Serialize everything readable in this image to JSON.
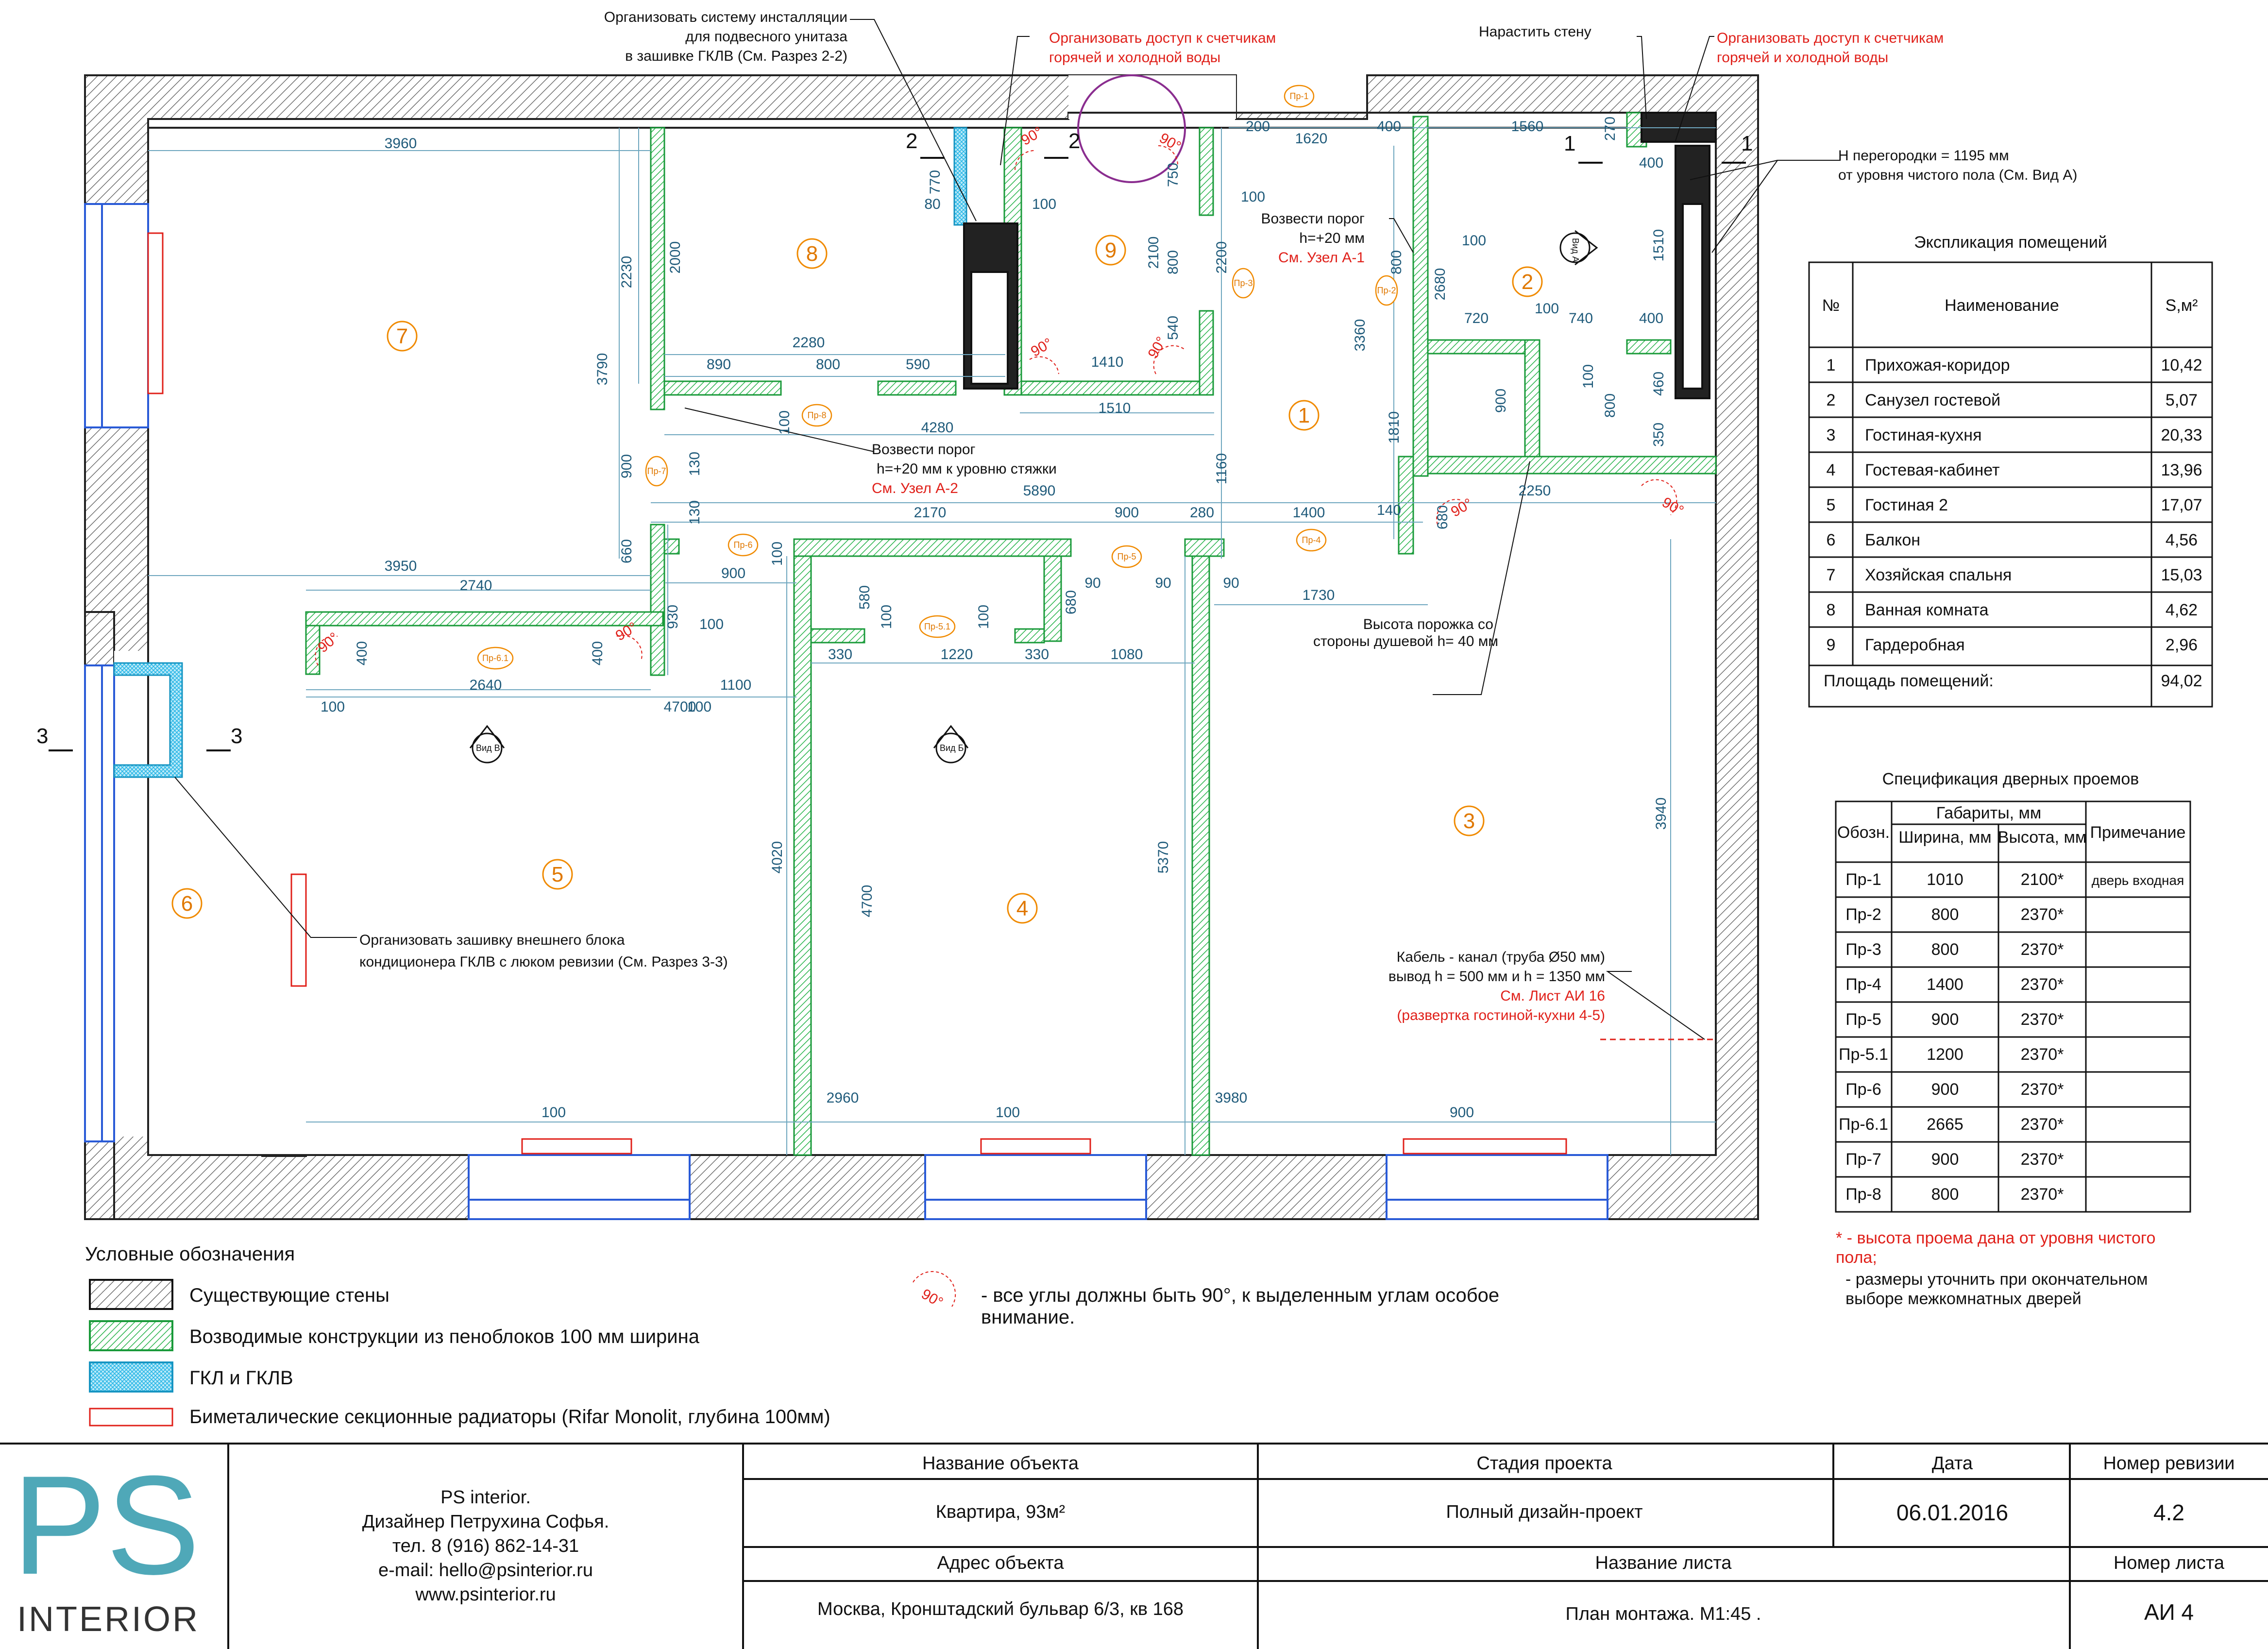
{
  "notes": {
    "installation": [
      "Организовать систему инсталляции",
      "для подвесного унитаза",
      "в зашивке ГКЛВ (См. Разрез 2-2)"
    ],
    "meters_1": [
      "Организовать доступ к счетчикам",
      "горячей и холодной воды"
    ],
    "meters_2": [
      "Организовать доступ к счетчикам",
      "горячей и холодной воды"
    ],
    "extend_wall": "Нарастить стену",
    "partition_height": [
      "Н перегородки = 1195 мм",
      "от уровня чистого пола  (См. Вид А)"
    ],
    "threshold_1": [
      "Возвести порог",
      "h=+20 мм"
    ],
    "threshold_1_ref": "См. Узел А-1",
    "threshold_2": [
      "Возвести порог",
      "h=+20 мм к уровню стяжки"
    ],
    "threshold_2_ref": "См. Узел А-2",
    "shower": [
      "Высота порожка со",
      "стороны душевой  h= 40 мм"
    ],
    "ac_unit": [
      "Организовать зашивку внешнего блока",
      "кондиционера ГКЛВ с люком ревизии  (См. Разрез 3-3)"
    ],
    "cable": [
      "Кабель - канал (труба Ø50 мм)",
      "вывод h = 500 мм и h = 1350 мм"
    ],
    "cable_ref": [
      "См. Лист АИ 16",
      "(развертка гостиной-кухни 4-5)"
    ],
    "angles": [
      "- все углы должны быть 90°, к выделенным углам особое",
      "внимание."
    ],
    "angle_mark": "90°",
    "view_a": "Вид А",
    "view_b": "Вид Б",
    "view_v": "Вид В",
    "sections": [
      "1",
      "2",
      "3"
    ]
  },
  "rooms": [
    "1",
    "2",
    "3",
    "4",
    "5",
    "6",
    "7",
    "8",
    "9"
  ],
  "doors": [
    "Пр-1",
    "Пр-2",
    "Пр-3",
    "Пр-4",
    "Пр-5",
    "Пр-5.1",
    "Пр-6",
    "Пр-6.1",
    "Пр-7",
    "Пр-8"
  ],
  "dims": [
    "3960",
    "2230",
    "2000",
    "3790",
    "2280",
    "890",
    "800",
    "590",
    "1410",
    "1510",
    "4280",
    "770",
    "80",
    "100",
    "200",
    "1620",
    "400",
    "1560",
    "270",
    "400",
    "750",
    "2100",
    "800",
    "540",
    "2200",
    "100",
    "3360",
    "800",
    "2680",
    "100",
    "720",
    "100",
    "740",
    "400",
    "1510",
    "460",
    "350",
    "900",
    "100",
    "800",
    "1810",
    "1160",
    "5890",
    "680",
    "140",
    "2250",
    "100",
    "900",
    "130",
    "660",
    "130",
    "2170",
    "900",
    "280",
    "1400",
    "3950",
    "2740",
    "900",
    "100",
    "930",
    "100",
    "580",
    "100",
    "100",
    "680",
    "90",
    "90",
    "90",
    "1730",
    "400",
    "400",
    "330",
    "1220",
    "330",
    "1080",
    "2640",
    "1100",
    "100",
    "100",
    "4700",
    "4020",
    "4700",
    "5370",
    "3940",
    "100",
    "2960",
    "100",
    "3980",
    "900"
  ],
  "explication": {
    "title": "Экспликация помещений",
    "headers": [
      "№",
      "Наименование",
      "S,м²"
    ],
    "rows": [
      [
        "1",
        "Прихожая-коридор",
        "10,42"
      ],
      [
        "2",
        "Санузел гостевой",
        "5,07"
      ],
      [
        "3",
        "Гостиная-кухня",
        "20,33"
      ],
      [
        "4",
        "Гостевая-кабинет",
        "13,96"
      ],
      [
        "5",
        "Гостиная 2",
        "17,07"
      ],
      [
        "6",
        "Балкон",
        "4,56"
      ],
      [
        "7",
        "Хозяйская спальня",
        "15,03"
      ],
      [
        "8",
        "Ванная комната",
        "4,62"
      ],
      [
        "9",
        "Гардеробная",
        "2,96"
      ]
    ],
    "total_label": "Площадь помещений:",
    "total_value": "94,02"
  },
  "door_spec": {
    "title": "Спецификация дверных проемов",
    "h_designation": "Обозн.",
    "h_dimensions": "Габариты, мм",
    "h_width": "Ширина, мм",
    "h_height": "Высота, мм",
    "h_note": "Примечание",
    "rows": [
      [
        "Пр-1",
        "1010",
        "2100*",
        "дверь входная"
      ],
      [
        "Пр-2",
        "800",
        "2370*",
        ""
      ],
      [
        "Пр-3",
        "800",
        "2370*",
        ""
      ],
      [
        "Пр-4",
        "1400",
        "2370*",
        ""
      ],
      [
        "Пр-5",
        "900",
        "2370*",
        ""
      ],
      [
        "Пр-5.1",
        "1200",
        "2370*",
        ""
      ],
      [
        "Пр-6",
        "900",
        "2370*",
        ""
      ],
      [
        "Пр-6.1",
        "2665",
        "2370*",
        ""
      ],
      [
        "Пр-7",
        "900",
        "2370*",
        ""
      ],
      [
        "Пр-8",
        "800",
        "2370*",
        ""
      ]
    ],
    "footnote_red": [
      "* - высота проема дана от уровня чистого",
      "пола;"
    ],
    "footnote_black": [
      "- размеры уточнить при окончательном",
      "выборе межкомнатных дверей"
    ]
  },
  "legend": {
    "title": "Условные обозначения",
    "items": [
      "Существующие стены",
      "Возводимые конструкции из  пеноблоков 100 мм  ширина",
      "ГКЛ и ГКЛВ",
      "Биметалические секционные радиаторы (Rifar Monolit, глубина 100мм)"
    ]
  },
  "title_block": {
    "logo_letters": "PS",
    "logo_word": "INTERIOR",
    "company": [
      "PS interior.",
      "Дизайнер Петрухина Софья.",
      "тел. 8 (916) 862-14-31",
      "e-mail:  hello@psinterior.ru",
      "www.psinterior.ru"
    ],
    "object_label": "Название объекта",
    "object_value": "Квартира, 93м²",
    "stage_label": "Стадия проекта",
    "stage_value": "Полный дизайн-проект",
    "date_label": "Дата",
    "date_value": "06.01.2016",
    "revision_label": "Номер ревизии",
    "revision_value": "4.2",
    "address_label": "Адрес объекта",
    "address_value": "Москва, Кронштадский бульвар 6/3, кв 168",
    "sheet_name_label": "Название листа",
    "sheet_name_value": "План монтажа. М1:45 .",
    "sheet_no_label": "Номер листа",
    "sheet_no_value": "АИ 4"
  },
  "colors": {
    "existing_wall": "#222222",
    "new_wall": "#27b34a",
    "gkl": "#23b5e6",
    "radiator": "#e0201a",
    "dimension": "#1e5a7a",
    "room_marker": "#f08a00",
    "callout": "#e0201a",
    "logo_ps": "#4fa8b8",
    "logo_interior": "#333333"
  }
}
